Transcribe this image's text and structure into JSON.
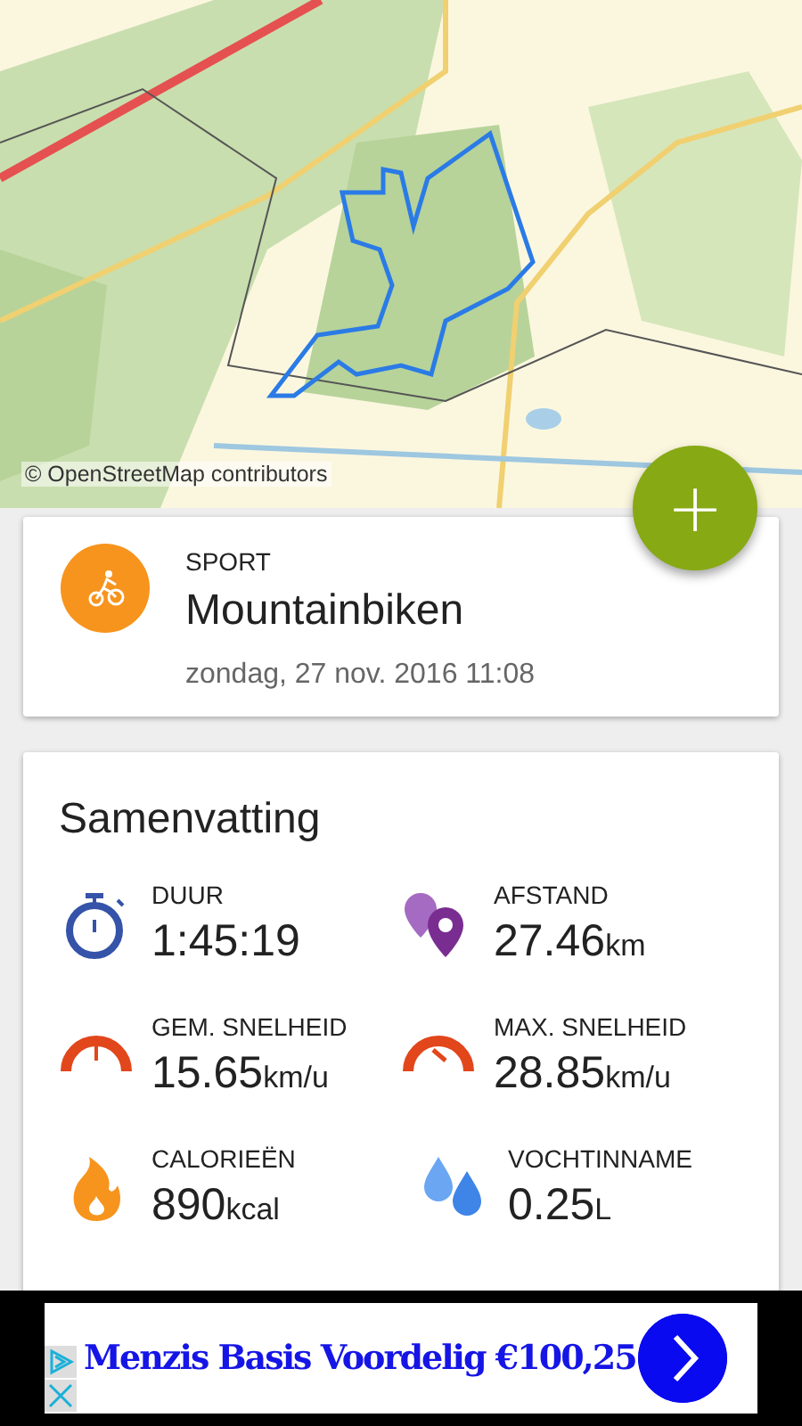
{
  "map": {
    "attribution": "© OpenStreetMap contributors"
  },
  "fab": {
    "label": "+"
  },
  "sport_card": {
    "label": "SPORT",
    "sport": "Mountainbiken",
    "date": "zondag, 27 nov. 2016 11:08"
  },
  "summary": {
    "title": "Samenvatting",
    "stats": [
      {
        "kind": "stopwatch",
        "label": "DUUR",
        "value": "1:45:19"
      },
      {
        "kind": "pins",
        "label": "AFSTAND",
        "value": "27.46",
        "unit": "km"
      },
      {
        "kind": "gauge",
        "label": "GEM. SNELHEID",
        "value": "15.65",
        "unit": "km/u"
      },
      {
        "kind": "gauge-max",
        "label": "MAX. SNELHEID",
        "value": "28.85",
        "unit": "km/u"
      },
      {
        "kind": "flame",
        "label": "CALORIEËN",
        "value": "890",
        "unit": "kcal"
      },
      {
        "kind": "drops",
        "label": "VOCHTINNAME",
        "value": "0.25",
        "unit": "L"
      }
    ]
  },
  "ad": {
    "text": "Menzis Basis Voordelig €100,25"
  }
}
